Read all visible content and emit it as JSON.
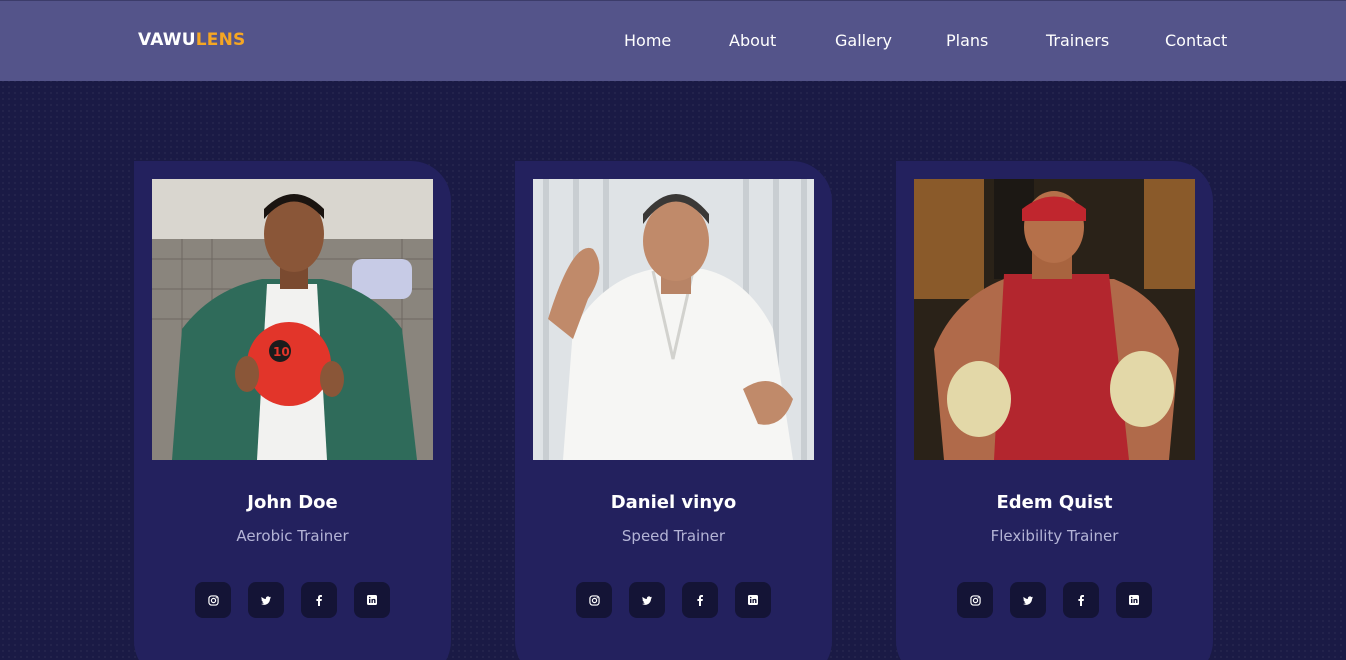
{
  "brand": {
    "part1": "VAWU",
    "part2": "LENS",
    "accent_color": "#f5a623"
  },
  "nav": {
    "items": [
      {
        "label": "Home"
      },
      {
        "label": "About"
      },
      {
        "label": "Gallery"
      },
      {
        "label": "Plans"
      },
      {
        "label": "Trainers"
      },
      {
        "label": "Contact"
      }
    ]
  },
  "colors": {
    "navbar": "#54548a",
    "page_background": "#1a1a45",
    "card": "#23215e",
    "social_button": "#141436",
    "role_text": "#b4b4d6"
  },
  "trainers": [
    {
      "name": "John Doe",
      "role": "Aerobic Trainer",
      "photo_subject": "man in green jacket holding red medicine ball",
      "socials": [
        "instagram-icon",
        "twitter-icon",
        "facebook-icon",
        "linkedin-icon"
      ]
    },
    {
      "name": "Daniel vinyo",
      "role": "Speed Trainer",
      "photo_subject": "man in white martial arts gi",
      "socials": [
        "instagram-icon",
        "twitter-icon",
        "facebook-icon",
        "linkedin-icon"
      ]
    },
    {
      "name": "Edem Quist",
      "role": "Flexibility Trainer",
      "photo_subject": "boxer in red tank top with boxing gloves",
      "socials": [
        "instagram-icon",
        "twitter-icon",
        "facebook-icon",
        "linkedin-icon"
      ]
    }
  ]
}
